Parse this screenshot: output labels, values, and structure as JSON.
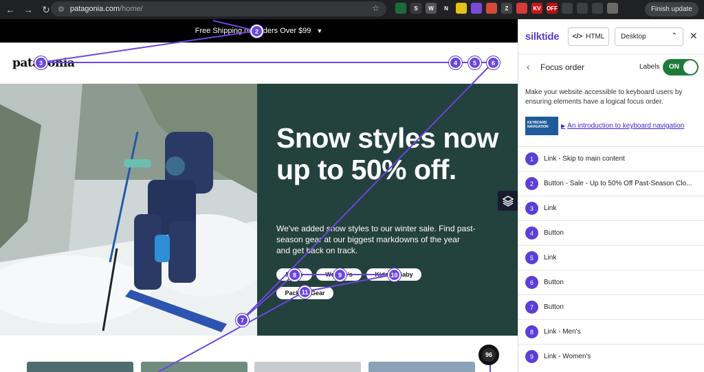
{
  "browser": {
    "url_host": "patagonia.com",
    "url_path": "/home/",
    "finish_update_label": "Finish update",
    "extensions": [
      {
        "name": "shield-icon",
        "color": "#1d6b3a",
        "label": ""
      },
      {
        "name": "s-icon",
        "color": "#3a3a3a",
        "label": "S"
      },
      {
        "name": "w-icon",
        "color": "#555555",
        "label": "W"
      },
      {
        "name": "n-icon",
        "color": "#222222",
        "label": "N"
      },
      {
        "name": "tv-icon",
        "color": "#e4c21a",
        "label": ""
      },
      {
        "name": "gear-icon",
        "color": "#7a4ad6",
        "label": ""
      },
      {
        "name": "color-icon",
        "color": "#d64a3a",
        "label": ""
      },
      {
        "name": "z-icon",
        "color": "#444444",
        "label": "Z"
      },
      {
        "name": "flag-icon",
        "color": "#d63a3a",
        "label": ""
      },
      {
        "name": "kv-icon",
        "color": "#c01b1b",
        "label": "KV"
      },
      {
        "name": "off-icon",
        "color": "#b51212",
        "label": "OFF"
      },
      {
        "name": "puzzle-icon",
        "color": "#3c4043",
        "label": ""
      },
      {
        "name": "cast-icon",
        "color": "#3c4043",
        "label": ""
      },
      {
        "name": "download-icon",
        "color": "#3c4043",
        "label": ""
      },
      {
        "name": "profile-icon",
        "color": "#6a6a6a",
        "label": ""
      }
    ]
  },
  "site": {
    "promo": "Free Shipping on Orders Over $99",
    "logo": "patagonia",
    "hero": {
      "title": "Snow styles now up to 50% off.",
      "text": "We've added snow styles to our winter sale. Find past-season gear at our biggest markdowns of the year and get back on track."
    },
    "chips": [
      "Men's",
      "Women's",
      "Kids' & Baby",
      "Packs & Gear"
    ]
  },
  "overlay": {
    "badges": [
      "2",
      "3",
      "4",
      "5",
      "6",
      "7",
      "8",
      "9",
      "10",
      "11",
      "96"
    ]
  },
  "panel": {
    "brand": "silktide",
    "html_label": "HTML",
    "device": "Desktop",
    "title": "Focus order",
    "labels_label": "Labels",
    "toggle_state": "ON",
    "intro": "Make your website accessible to keyboard users by ensuring elements have a logical focus order.",
    "video_thumb_text": "KEYBOARD NAVIGATION",
    "video_link": "An introduction to keyboard navigation",
    "items": [
      {
        "n": "1",
        "label": "Link - Skip to main content"
      },
      {
        "n": "2",
        "label": "Button - Sale - Up to 50% Off Past-Season Clo..."
      },
      {
        "n": "3",
        "label": "Link"
      },
      {
        "n": "4",
        "label": "Button"
      },
      {
        "n": "5",
        "label": "Link"
      },
      {
        "n": "6",
        "label": "Button"
      },
      {
        "n": "7",
        "label": "Button"
      },
      {
        "n": "8",
        "label": "Link - Men's"
      },
      {
        "n": "9",
        "label": "Link - Women's"
      }
    ]
  }
}
